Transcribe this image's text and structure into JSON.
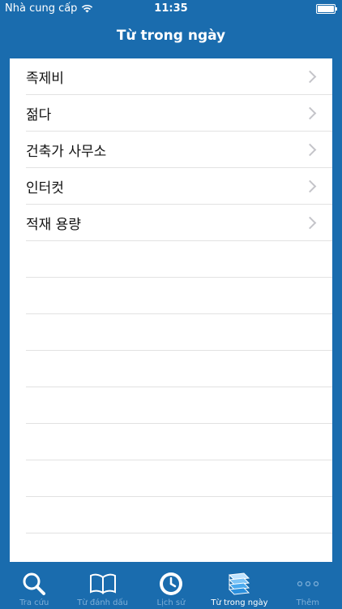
{
  "status": {
    "carrier": "Nhà cung cấp",
    "time": "11:35"
  },
  "nav": {
    "title": "Từ trong ngày"
  },
  "list": {
    "items": [
      {
        "label": "족제비"
      },
      {
        "label": "젊다"
      },
      {
        "label": "건축가 사무소"
      },
      {
        "label": "인터컷"
      },
      {
        "label": "적재 용량"
      }
    ]
  },
  "tabs": [
    {
      "label": "Tra cứu",
      "icon": "search-icon"
    },
    {
      "label": "Từ đánh dấu",
      "icon": "book-icon"
    },
    {
      "label": "Lịch sử",
      "icon": "history-clock-icon"
    },
    {
      "label": "Từ trong ngày",
      "icon": "word-of-day-stack-icon"
    },
    {
      "label": "Thêm",
      "icon": "more-dots-icon"
    }
  ],
  "colors": {
    "background": "#1a6cae",
    "tab_inactive": "#7fb0d9",
    "tab_active": "#ffffff"
  }
}
